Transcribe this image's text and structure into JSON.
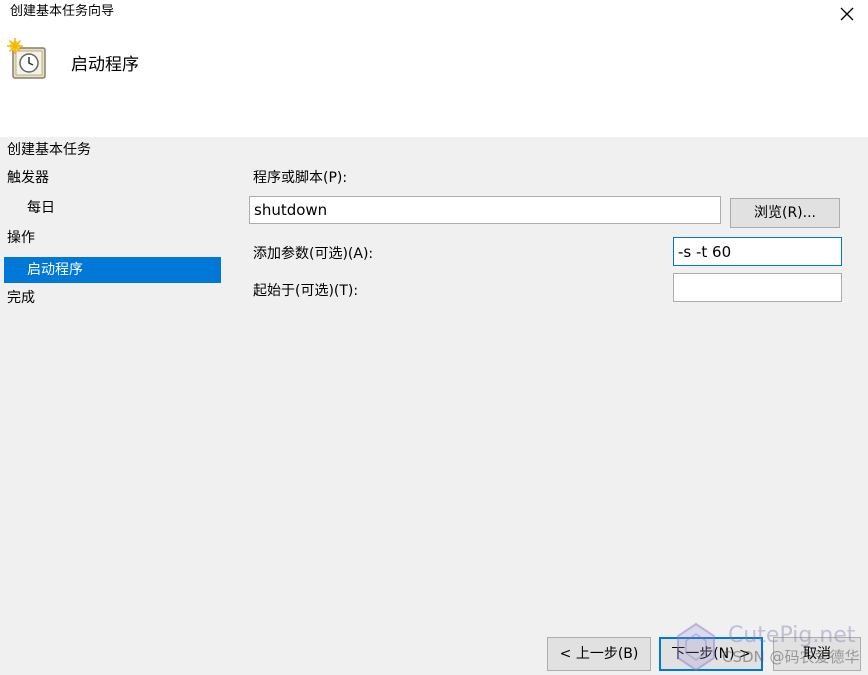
{
  "window": {
    "title": "创建基本任务向导",
    "close_icon": "close-icon"
  },
  "header": {
    "icon": "task-scheduler-clock-icon",
    "title": "启动程序"
  },
  "nav": {
    "items": [
      {
        "label": "创建基本任务",
        "selected": false
      },
      {
        "label": "触发器",
        "selected": false
      },
      {
        "label": "每日",
        "selected": false
      },
      {
        "label": "操作",
        "selected": false
      },
      {
        "label": "启动程序",
        "selected": true
      },
      {
        "label": "完成",
        "selected": false
      }
    ]
  },
  "form": {
    "program_label": "程序或脚本(P):",
    "program_value": "shutdown",
    "browse_label": "浏览(R)...",
    "args_label": "添加参数(可选)(A):",
    "args_value": "-s -t 60",
    "start_in_label": "起始于(可选)(T):",
    "start_in_value": ""
  },
  "footer": {
    "back_label": "< 上一步(B)",
    "next_label": "下一步(N) >",
    "cancel_label": "取消"
  },
  "watermark": {
    "site": "CutePig.net",
    "author": "CSDN @码农爱德华"
  },
  "colors": {
    "selection": "#0078d7",
    "focus_border": "#0078d7",
    "panel_bg": "#f0f0f0",
    "header_bg": "#ffffff"
  }
}
